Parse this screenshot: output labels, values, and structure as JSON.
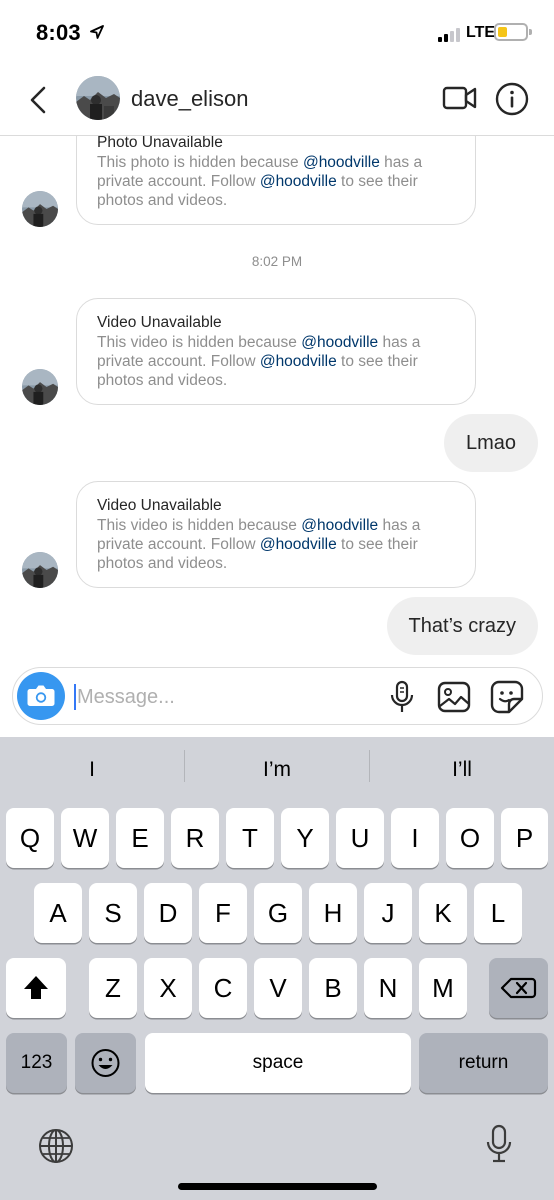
{
  "status_bar": {
    "time": "8:03",
    "network": "LTE",
    "colors": {
      "battery_fill": "#f5c518"
    }
  },
  "header": {
    "username": "dave_elison",
    "icons": [
      "back-icon",
      "avatar",
      "video-call-icon",
      "info-icon"
    ]
  },
  "thread": {
    "messages": [
      {
        "type": "unavailable",
        "title": "Photo Unavailable",
        "body_prefix": "This photo is hidden because ",
        "mention": "@hoodville",
        "body_middle": " has a private account. Follow ",
        "mention2": "@hoodville",
        "body_suffix": " to see their photos and videos."
      },
      {
        "type": "timestamp",
        "text": "8:02 PM"
      },
      {
        "type": "unavailable",
        "title": "Video Unavailable",
        "body_prefix": "This video is hidden because ",
        "mention": "@hoodville",
        "body_middle": " has a private account. Follow ",
        "mention2": "@hoodville",
        "body_suffix": " to see their photos and videos."
      },
      {
        "type": "outgoing",
        "text": "Lmao"
      },
      {
        "type": "unavailable",
        "title": "Video Unavailable",
        "body_prefix": "This video is hidden because ",
        "mention": "@hoodville",
        "body_middle": " has a private account. Follow ",
        "mention2": "@hoodville",
        "body_suffix": " to see their photos and videos."
      },
      {
        "type": "outgoing",
        "text": "That’s crazy"
      }
    ]
  },
  "composer": {
    "placeholder": "Message...",
    "value": "",
    "colors": {
      "camera": "#3797f0"
    }
  },
  "keyboard": {
    "suggestions": [
      "I",
      "I’m",
      "I’ll"
    ],
    "row1": [
      "Q",
      "W",
      "E",
      "R",
      "T",
      "Y",
      "U",
      "I",
      "O",
      "P"
    ],
    "row2": [
      "A",
      "S",
      "D",
      "F",
      "G",
      "H",
      "J",
      "K",
      "L"
    ],
    "row3": [
      "Z",
      "X",
      "C",
      "V",
      "B",
      "N",
      "M"
    ],
    "numbers_label": "123",
    "space_label": "space",
    "return_label": "return"
  }
}
